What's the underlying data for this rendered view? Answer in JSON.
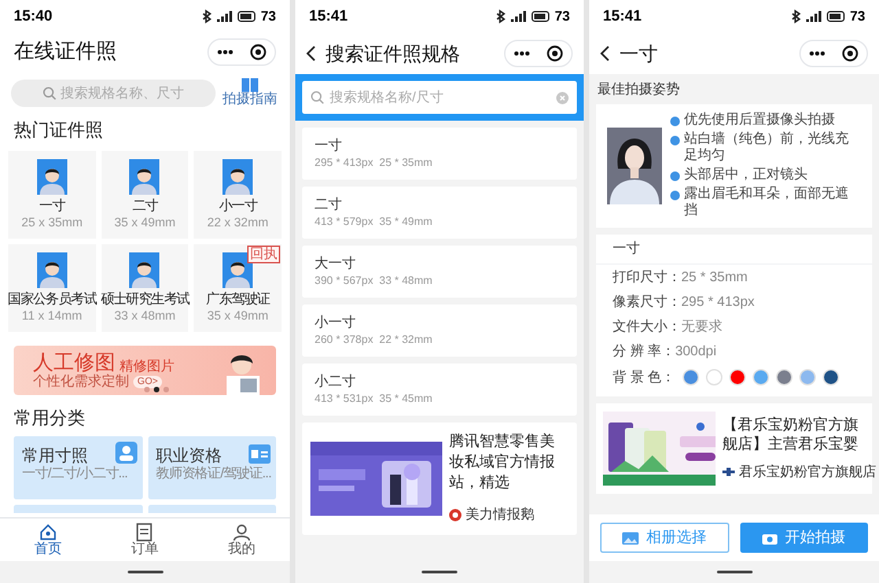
{
  "home": {
    "status": {
      "time": "15:40",
      "battery": "73"
    },
    "title": "在线证件照",
    "search": {
      "placeholder": "搜索规格名称、尺寸"
    },
    "guide_label": "拍摄指南",
    "hot_title": "热门证件照",
    "hot_items": [
      {
        "name": "一寸",
        "size": "25 x 35mm"
      },
      {
        "name": "二寸",
        "size": "35 x 49mm"
      },
      {
        "name": "小一寸",
        "size": "22 x 32mm"
      },
      {
        "name": "国家公务员考试",
        "size": "11 x 14mm"
      },
      {
        "name": "硕士研究生考试",
        "size": "33 x 48mm"
      },
      {
        "name": "广东驾驶证",
        "size": "35 x 49mm",
        "badge": "回执"
      }
    ],
    "banner": {
      "title": "人工修图",
      "tag": "精修图片",
      "subtitle": "个性化需求定制",
      "button": "GO>",
      "dots": [
        {
          "selected": false
        },
        {
          "selected": true
        },
        {
          "selected": false
        }
      ]
    },
    "category_title": "常用分类",
    "categories": [
      {
        "title": "常用寸照",
        "desc": "一寸/二寸/小二寸..."
      },
      {
        "title": "职业资格",
        "desc": "教师资格证/驾驶证..."
      }
    ],
    "tabs": [
      {
        "label": "首页",
        "selected": true
      },
      {
        "label": "订单",
        "selected": false
      },
      {
        "label": "我的",
        "selected": false
      }
    ]
  },
  "search": {
    "status": {
      "time": "15:41",
      "battery": "73"
    },
    "title": "搜索证件照规格",
    "search": {
      "placeholder": "搜索规格名称/尺寸"
    },
    "results": [
      {
        "name": "一寸",
        "spec": "295 * 413px  25 * 35mm"
      },
      {
        "name": "二寸",
        "spec": "413 * 579px  35 * 49mm"
      },
      {
        "name": "大一寸",
        "spec": "390 * 567px  33 * 48mm"
      },
      {
        "name": "小一寸",
        "spec": "260 * 378px  22 * 32mm"
      },
      {
        "name": "小二寸",
        "spec": "413 * 531px  35 * 45mm"
      }
    ],
    "ad": {
      "text": "腾讯智慧零售美妆私域官方情报站，精选",
      "source": "美力情报鹅"
    }
  },
  "detail": {
    "status": {
      "time": "15:41",
      "battery": "73"
    },
    "title": "一寸",
    "pose_title": "最佳拍摄姿势",
    "tips": [
      "优先使用后置摄像头拍摄",
      "站白墙（纯色）前，光线充足均匀",
      "头部居中，正对镜头",
      "露出眉毛和耳朵，面部无遮挡"
    ],
    "spec_title": "一寸",
    "specs": [
      {
        "label": "打印尺寸：",
        "value": "25 * 35mm"
      },
      {
        "label": "像素尺寸：",
        "value": "295 * 413px"
      },
      {
        "label": "文件大小：",
        "value": "无要求"
      },
      {
        "label": "分 辨 率：",
        "value": "300dpi"
      }
    ],
    "bg_label": "背 景 色：",
    "bg_colors": [
      {
        "color": "#4a8fdf"
      },
      {
        "color": "#ffffff"
      },
      {
        "color": "#ff0000"
      },
      {
        "color": "#5aaaf0"
      },
      {
        "color": "#7b7f8e"
      },
      {
        "color": "#8db9ef"
      },
      {
        "color": "#1f5287"
      }
    ],
    "ad": {
      "text": "【君乐宝奶粉官方旗舰店】主营君乐宝婴",
      "source": "君乐宝奶粉官方旗舰店"
    },
    "buttons": [
      {
        "label": "相册选择",
        "kind": "outline"
      },
      {
        "label": "开始拍摄",
        "kind": "primary"
      }
    ]
  }
}
